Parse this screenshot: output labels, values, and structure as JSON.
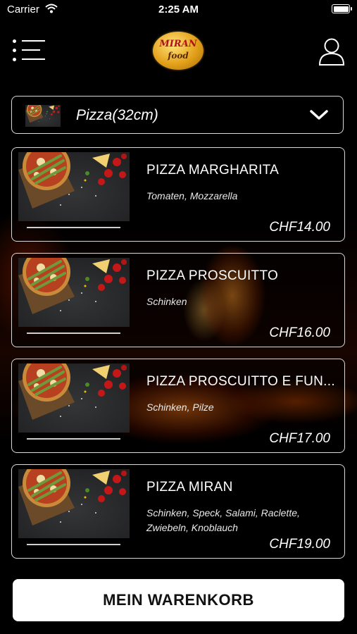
{
  "status_bar": {
    "carrier": "Carrier",
    "time": "2:25 AM",
    "icons": [
      "wifi-icon",
      "battery-icon"
    ]
  },
  "header": {
    "logo_line1": "MIRAN",
    "logo_line2": "food",
    "menu_icon": "menu-icon",
    "user_icon": "user-icon"
  },
  "category": {
    "selected": "Pizza(32cm)",
    "icon": "chevron-down-icon"
  },
  "products": [
    {
      "name": "PIZZA MARGHARITA",
      "description": "Tomaten, Mozzarella",
      "price": "CHF14.00"
    },
    {
      "name": "PIZZA PROSCUITTO",
      "description": "Schinken",
      "price": "CHF16.00"
    },
    {
      "name": "PIZZA PROSCUITTO E FUN...",
      "description": "Schinken, Pilze",
      "price": "CHF17.00"
    },
    {
      "name": "PIZZA MIRAN",
      "description": "Schinken, Speck, Salami, Raclette, Zwiebeln, Knoblauch",
      "price": "CHF19.00"
    }
  ],
  "basket": {
    "label": "MEIN WARENKORB"
  },
  "colors": {
    "background": "#000000",
    "border": "#d9d9d9",
    "button_bg": "#ffffff",
    "logo_gold": "#e3a11a",
    "logo_red": "#b0121a"
  }
}
